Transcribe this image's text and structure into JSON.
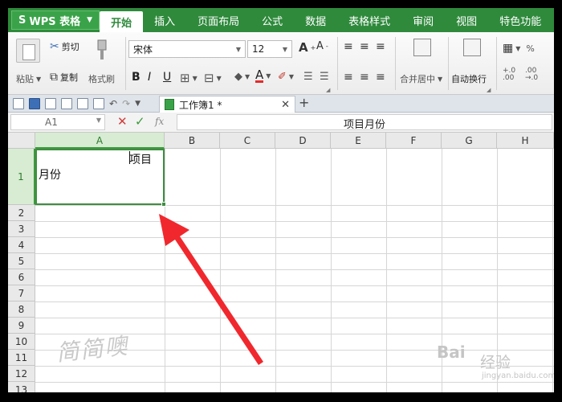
{
  "app": {
    "name": "WPS 表格",
    "logo_glyph": "S"
  },
  "menu": {
    "tabs": [
      "开始",
      "插入",
      "页面布局",
      "公式",
      "数据",
      "表格样式",
      "审阅",
      "视图",
      "特色功能"
    ],
    "active": "开始"
  },
  "ribbon": {
    "cut": "剪切",
    "copy": "复制",
    "paste": "粘贴",
    "format_painter": "格式刷",
    "font_name": "宋体",
    "font_size": "12",
    "bold": "B",
    "italic": "I",
    "underline": "U",
    "grow_font": "A",
    "shrink_font": "A",
    "font_color": "A",
    "merge_center": "合并居中",
    "wrap_text": "自动换行",
    "percent": "%",
    "inc_decimal": "+.0\n.00",
    "dec_decimal": ".00\n→.0"
  },
  "doc_tabs": {
    "workbook_name": "工作簿1 *",
    "new_tab": "+",
    "close": "✕"
  },
  "formula_bar": {
    "name_box": "A1",
    "content": "项目月份",
    "cancel": "✕",
    "confirm": "✓",
    "fx": "fx"
  },
  "sheet": {
    "columns": [
      "A",
      "B",
      "C",
      "D",
      "E",
      "F",
      "G",
      "H"
    ],
    "rows": [
      "1",
      "2",
      "3",
      "4",
      "5",
      "6",
      "7",
      "8",
      "9",
      "10",
      "11",
      "12",
      "13"
    ],
    "selected_column": "A",
    "selected_row": "1",
    "cell_a1": {
      "top_text": "项目",
      "bottom_text": "月份"
    }
  },
  "overlays": {
    "handwriting": "简简噢",
    "watermark_brand": "Bai",
    "watermark_brand2": "经验",
    "watermark_url": "jingyan.baidu.com"
  },
  "colors": {
    "menubar": "#2f8a3c",
    "selection": "#3e8e41",
    "arrow": "#f0282d"
  }
}
